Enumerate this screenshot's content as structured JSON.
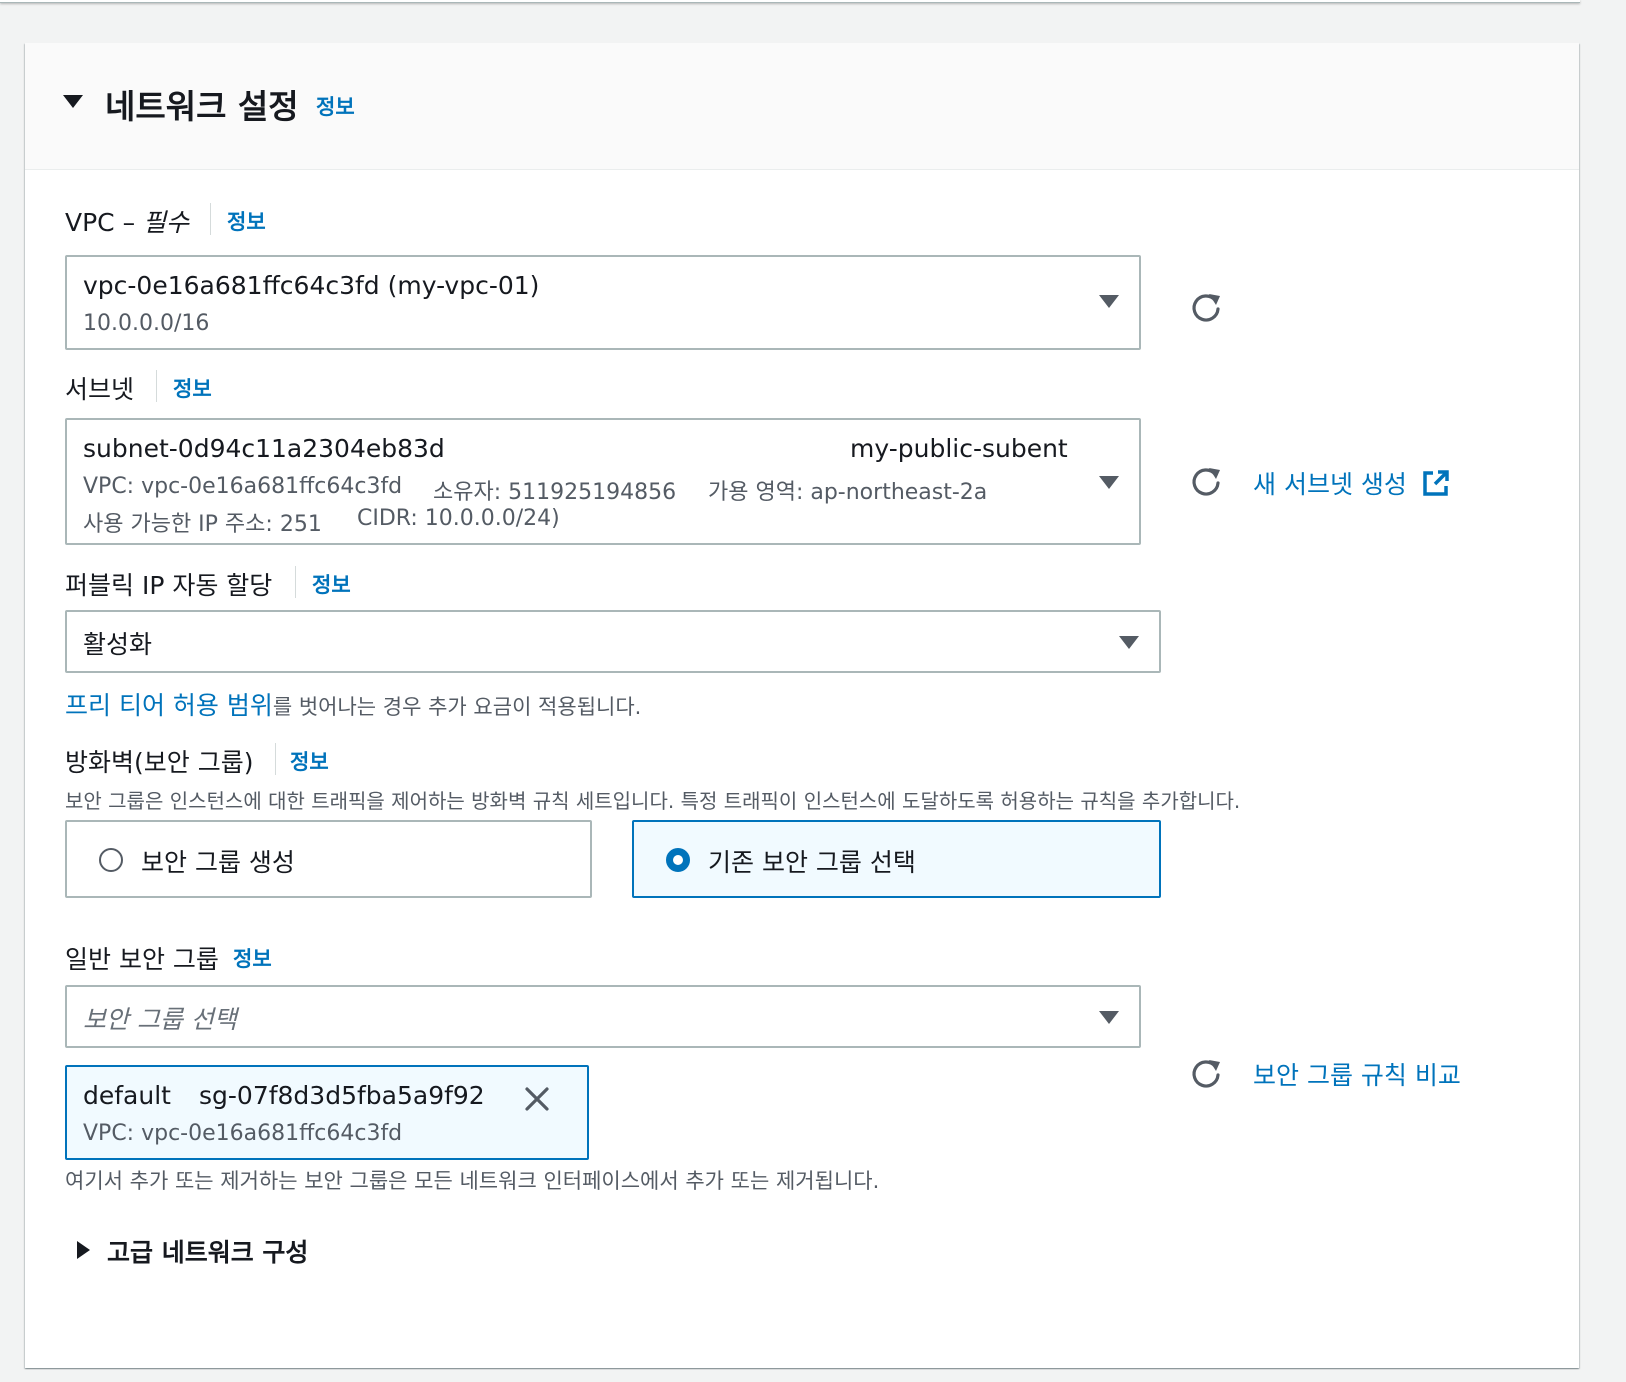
{
  "section": {
    "title": "네트워크 설정",
    "info": "정보"
  },
  "vpc": {
    "label": "VPC – ",
    "required": "필수",
    "info": "정보",
    "selected_id": "vpc-0e16a681ffc64c3fd (my-vpc-01)",
    "selected_cidr": "10.0.0.0/16"
  },
  "subnet": {
    "label": "서브넷",
    "info": "정보",
    "selected_id": "subnet-0d94c11a2304eb83d",
    "selected_name": "my-public-subent",
    "vpc_line": "VPC: vpc-0e16a681ffc64c3fd",
    "owner": "소유자: 511925194856",
    "az": "가용 영역: ap-northeast-2a",
    "ips": "사용 가능한 IP 주소: 251",
    "cidr": "CIDR: 10.0.0.0/24)",
    "create_link": "새 서브넷 생성"
  },
  "public_ip": {
    "label": "퍼블릭 IP 자동 할당",
    "info": "정보",
    "value": "활성화",
    "note_link": "프리 티어 허용 범위",
    "note_text": "를 벗어나는 경우 추가 요금이 적용됩니다."
  },
  "firewall": {
    "label": "방화벽(보안 그룹)",
    "info": "정보",
    "description": "보안 그룹은 인스턴스에 대한 트래픽을 제어하는 방화벽 규칙 세트입니다. 특정 트래픽이 인스턴스에 도달하도록 허용하는 규칙을 추가합니다.",
    "options": [
      {
        "label": "보안 그룹 생성",
        "selected": false
      },
      {
        "label": "기존 보안 그룹 선택",
        "selected": true
      }
    ]
  },
  "common_sg": {
    "label": "일반 보안 그룹",
    "info": "정보",
    "placeholder": "보안 그룹 선택",
    "token_name": "default",
    "token_id": "sg-07f8d3d5fba5a9f92",
    "token_vpc": "VPC: vpc-0e16a681ffc64c3fd",
    "compare_link": "보안 그룹 규칙 비교",
    "note": "여기서 추가 또는 제거하는 보안 그룹은 모든 네트워크 인터페이스에서 추가 또는 제거됩니다."
  },
  "advanced": {
    "label": "고급 네트워크 구성"
  },
  "icons": [
    "caret-down-icon",
    "refresh-icon",
    "external-link-icon",
    "close-icon",
    "caret-right-icon"
  ],
  "colors": {
    "link": "#0073bb",
    "text": "#16191f",
    "muted": "#545b64",
    "border": "#aab7b8"
  }
}
